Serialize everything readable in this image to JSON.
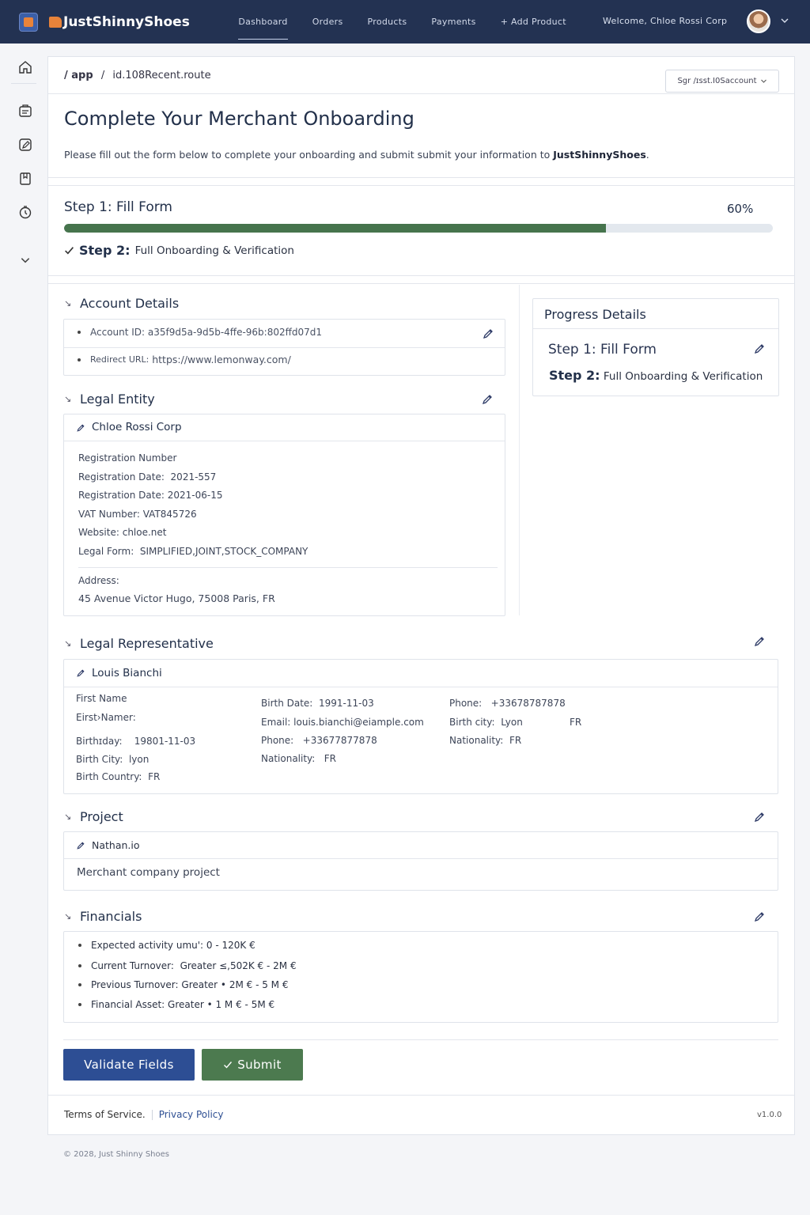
{
  "topbar": {
    "brand": "JustShinnyShoes",
    "nav": [
      "Dashboard",
      "Orders",
      "Products",
      "Payments",
      "+ Add Product"
    ],
    "welcome": "Welcome, Chloe Rossi Corp"
  },
  "breadcrumb": {
    "root": "/ app",
    "sep": "/",
    "route": "id.108Recent.route"
  },
  "account_select": {
    "value": "Sgr /ɪsst.I0Saccount"
  },
  "page": {
    "title": "Complete Your Merchant Onboarding",
    "intro_prefix": "Please fill out the form below to complete your onboarding and submit submit your information to ",
    "intro_brand": "JustShinnyShoes",
    "intro_suffix": "."
  },
  "progress": {
    "step1_title": "Step 1: Fill Form",
    "percent_label": "60%",
    "percent_value": 0.765,
    "step2_strong": "Step 2:",
    "step2_text": "Full Onboarding & Verification"
  },
  "account_details": {
    "title": "Account Details",
    "rows": [
      {
        "label": "Account ID:",
        "value": "a35f9d5a-9d5b-4ffe-96b:802ffd07d1"
      },
      {
        "label": "Redirect URL:",
        "value": "https://www.lemonway.com/"
      }
    ]
  },
  "progress_details": {
    "title": "Progress Details",
    "step1": "Step 1: Fill Form",
    "step2_strong": "Step 2:",
    "step2_text": "Full Onboarding & Verification"
  },
  "legal_entity": {
    "title": "Legal Entity",
    "name": "Chloe Rossi Corp",
    "rows": [
      {
        "label": "Registration Number",
        "value": ""
      },
      {
        "label": "Registration Date:",
        "value": "2021-557"
      },
      {
        "label": "Registration Date:",
        "value": "2021-06-15"
      },
      {
        "label": "VAT Number:",
        "value": "VAT845726"
      },
      {
        "label": "Website:",
        "value": "chloe.net"
      },
      {
        "label": "Legal Form:",
        "value": "SIMPLIFIED,JOINT,STOCK_COMPANY"
      }
    ],
    "address_label": "Address:",
    "address_value": "45 Avenue Victor Hugo, 75008 Paris, FR"
  },
  "legal_rep": {
    "title": "Legal Representative",
    "name": "Louis Bianchi",
    "col1": [
      {
        "label": "First Name",
        "value": ""
      },
      {
        "label": "Eirst›Namer:",
        "value": ""
      },
      {
        "label": "Birthɪday:",
        "value": "19801-11-03"
      },
      {
        "label": "Birth City:",
        "value": "lyon"
      },
      {
        "label": "Birth Country:",
        "value": "FR"
      }
    ],
    "col2": [
      {
        "label": "Birth Date:",
        "value": "1991-11-03"
      },
      {
        "label": "Email:",
        "value": "louis.bianchi@eiample.com"
      },
      {
        "label": "Phone:",
        "value": "+33677877878"
      },
      {
        "label": "Nationality:",
        "value": "FR"
      }
    ],
    "col3": [
      {
        "label": "Phone:",
        "value": "+33678787878"
      },
      {
        "label": "Birth city:",
        "value": "Lyon"
      },
      {
        "label": "Nationality:",
        "value": "FR"
      }
    ],
    "extra_fr": "FR"
  },
  "project": {
    "title": "Project",
    "name": "Nathan.io",
    "description": "Merchant company project"
  },
  "financials": {
    "title": "Financials",
    "rows": [
      {
        "label": "Expected activity umu':",
        "value": "0 - 120K €"
      },
      {
        "label": "Current Turnover:",
        "value": "Greater ≤,502K € - 2M €"
      },
      {
        "label": "Previous Turnover:",
        "value": "Greater • 2M € - 5 M €"
      },
      {
        "label": "Financial Asset:",
        "value": "Greater • 1 M € - 5M €"
      }
    ]
  },
  "actions": {
    "validate": "Validate Fields",
    "submit": "Submit"
  },
  "footer": {
    "terms": "Terms of Service.",
    "privacy": "Privacy Policy",
    "version": "v1.0.0",
    "copyright": "© 2028, Just Shinny Shoes"
  },
  "colors": {
    "topbar": "#233252",
    "accent_blue": "#2d4e94",
    "accent_green": "#4c7a4f",
    "progress_fill": "#46744d"
  }
}
